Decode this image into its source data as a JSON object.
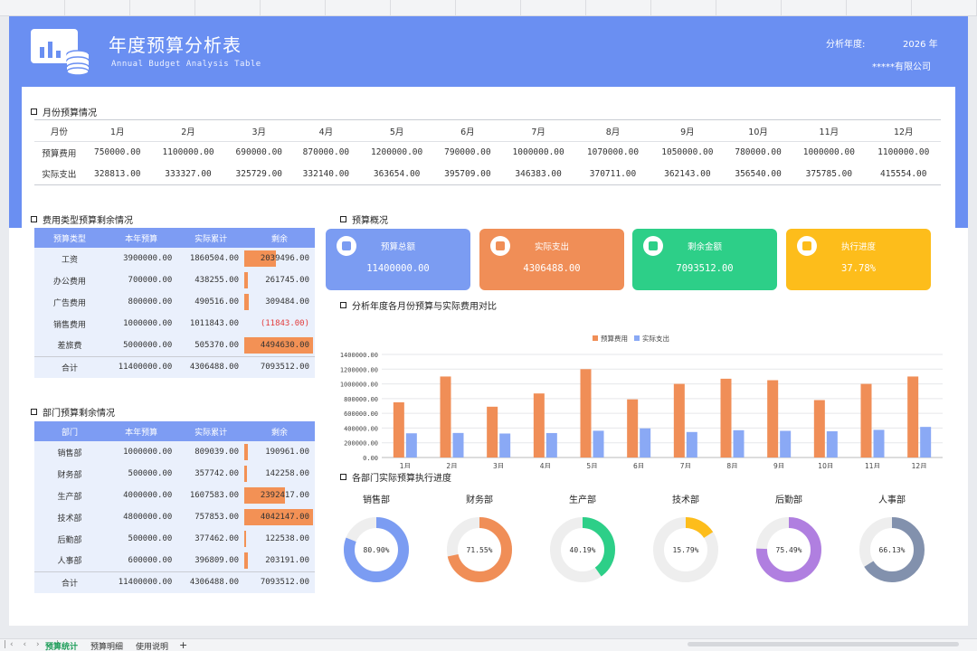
{
  "header": {
    "title": "年度预算分析表",
    "subtitle": "Annual Budget Analysis Table",
    "year_label": "分析年度:",
    "year_value": "2026 年",
    "company": "*****有限公司"
  },
  "monthly": {
    "section_title": "月份预算情况",
    "row_labels": {
      "month": "月份",
      "budget": "预算费用",
      "actual": "实际支出"
    },
    "months": [
      "1月",
      "2月",
      "3月",
      "4月",
      "5月",
      "6月",
      "7月",
      "8月",
      "9月",
      "10月",
      "11月",
      "12月"
    ],
    "budget": [
      "750000.00",
      "1100000.00",
      "690000.00",
      "870000.00",
      "1200000.00",
      "790000.00",
      "1000000.00",
      "1070000.00",
      "1050000.00",
      "780000.00",
      "1000000.00",
      "1100000.00"
    ],
    "actual": [
      "328813.00",
      "333327.00",
      "325729.00",
      "332140.00",
      "363654.00",
      "395709.00",
      "346383.00",
      "370711.00",
      "362143.00",
      "356540.00",
      "375785.00",
      "415554.00"
    ]
  },
  "expense_type": {
    "section_title": "费用类型预算剩余情况",
    "headers": [
      "预算类型",
      "本年预算",
      "实际累计",
      "剩余"
    ],
    "rows": [
      {
        "name": "工资",
        "budget": "3900000.00",
        "actual": "1860504.00",
        "remaining": "2039496.00",
        "remaining_value": 2039496
      },
      {
        "name": "办公费用",
        "budget": "700000.00",
        "actual": "438255.00",
        "remaining": "261745.00",
        "remaining_value": 261745
      },
      {
        "name": "广告费用",
        "budget": "800000.00",
        "actual": "490516.00",
        "remaining": "309484.00",
        "remaining_value": 309484
      },
      {
        "name": "销售费用",
        "budget": "1000000.00",
        "actual": "1011843.00",
        "remaining": "(11843.00)",
        "remaining_value": -11843
      },
      {
        "name": "差旅费",
        "budget": "5000000.00",
        "actual": "505370.00",
        "remaining": "4494630.00",
        "remaining_value": 4494630
      }
    ],
    "total": {
      "name": "合计",
      "budget": "11400000.00",
      "actual": "4306488.00",
      "remaining": "7093512.00"
    }
  },
  "department": {
    "section_title": "部门预算剩余情况",
    "headers": [
      "部门",
      "本年预算",
      "实际累计",
      "剩余"
    ],
    "rows": [
      {
        "name": "销售部",
        "budget": "1000000.00",
        "actual": "809039.00",
        "remaining": "190961.00",
        "remaining_value": 190961
      },
      {
        "name": "财务部",
        "budget": "500000.00",
        "actual": "357742.00",
        "remaining": "142258.00",
        "remaining_value": 142258
      },
      {
        "name": "生产部",
        "budget": "4000000.00",
        "actual": "1607583.00",
        "remaining": "2392417.00",
        "remaining_value": 2392417
      },
      {
        "name": "技术部",
        "budget": "4800000.00",
        "actual": "757853.00",
        "remaining": "4042147.00",
        "remaining_value": 4042147
      },
      {
        "name": "后勤部",
        "budget": "500000.00",
        "actual": "377462.00",
        "remaining": "122538.00",
        "remaining_value": 122538
      },
      {
        "name": "人事部",
        "budget": "600000.00",
        "actual": "396809.00",
        "remaining": "203191.00",
        "remaining_value": 203191
      }
    ],
    "total": {
      "name": "合计",
      "budget": "11400000.00",
      "actual": "4306488.00",
      "remaining": "7093512.00"
    }
  },
  "overview": {
    "section_title": "预算概况",
    "cards": [
      {
        "label": "预算总额",
        "value": "11400000.00",
        "color": "#7b9cf2",
        "icon": "wallet-icon"
      },
      {
        "label": "实际支出",
        "value": "4306488.00",
        "color": "#f08e57",
        "icon": "payment-icon"
      },
      {
        "label": "剩余金额",
        "value": "7093512.00",
        "color": "#2dcf88",
        "icon": "dollar-icon"
      },
      {
        "label": "执行进度",
        "value": "37.78%",
        "color": "#fdbd1b",
        "icon": "pie-icon"
      }
    ]
  },
  "chart_section_title": "分析年度各月份预算与实际费用对比",
  "chart_data": {
    "type": "bar",
    "categories": [
      "1月",
      "2月",
      "3月",
      "4月",
      "5月",
      "6月",
      "7月",
      "8月",
      "9月",
      "10月",
      "11月",
      "12月"
    ],
    "series": [
      {
        "name": "预算费用",
        "color": "#f08e57",
        "values": [
          750000,
          1100000,
          690000,
          870000,
          1200000,
          790000,
          1000000,
          1070000,
          1050000,
          780000,
          1000000,
          1100000
        ]
      },
      {
        "name": "实际支出",
        "color": "#8aa9f5",
        "values": [
          328813,
          333327,
          325729,
          332140,
          363654,
          395709,
          346383,
          370711,
          362143,
          356540,
          375785,
          415554
        ]
      }
    ],
    "ylim": [
      0,
      1400000
    ],
    "yticks": [
      "0.00",
      "200000.00",
      "400000.00",
      "600000.00",
      "800000.00",
      "1000000.00",
      "1200000.00",
      "1400000.00"
    ],
    "legend": "top-center",
    "grid": true
  },
  "progress": {
    "section_title": "各部门实际预算执行进度",
    "items": [
      {
        "name": "销售部",
        "label": "80.90%",
        "value": 0.809,
        "color": "#7b9cf2"
      },
      {
        "name": "财务部",
        "label": "71.55%",
        "value": 0.7155,
        "color": "#f08e57"
      },
      {
        "name": "生产部",
        "label": "40.19%",
        "value": 0.4019,
        "color": "#2dcf88"
      },
      {
        "name": "技术部",
        "label": "15.79%",
        "value": 0.1579,
        "color": "#fdbd1b"
      },
      {
        "name": "后勤部",
        "label": "75.49%",
        "value": 0.7549,
        "color": "#b07fe0"
      },
      {
        "name": "人事部",
        "label": "66.13%",
        "value": 0.6613,
        "color": "#8291ad"
      }
    ]
  },
  "sheet_tabs": {
    "nav": "|‹ ‹ › ›|",
    "tabs": [
      "预算统计",
      "预算明细",
      "使用说明"
    ],
    "add": "+"
  }
}
